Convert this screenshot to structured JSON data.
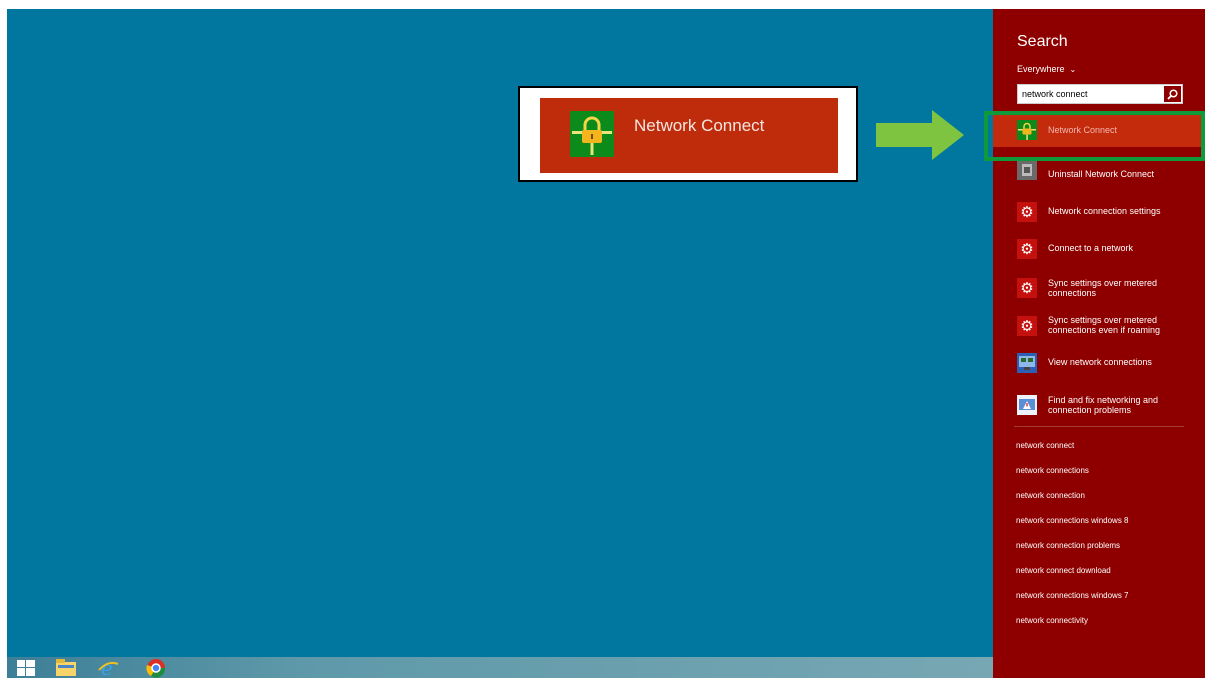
{
  "desktop": {
    "background": "#01779f"
  },
  "callout": {
    "label": "Network Connect"
  },
  "charm": {
    "title": "Search",
    "scope_label": "Everywhere",
    "search": {
      "value": "network connect"
    },
    "results": [
      {
        "icon": "network-connect-lock-icon",
        "dim": "",
        "bold": "Network Connect",
        "label": "Network Connect"
      },
      {
        "icon": "uninstall-program-icon",
        "label": "Uninstall Network Connect"
      },
      {
        "icon": "settings-gear-icon",
        "label": "Network connection settings"
      },
      {
        "icon": "settings-gear-icon",
        "label": "Connect to a network"
      },
      {
        "icon": "settings-gear-icon",
        "label": "Sync settings over metered connections"
      },
      {
        "icon": "settings-gear-icon",
        "label": "Sync settings over metered connections even if roaming"
      },
      {
        "icon": "network-connections-icon",
        "label": "View network connections"
      },
      {
        "icon": "troubleshoot-icon",
        "label": "Find and fix networking and connection problems"
      }
    ],
    "suggestions": [
      "network connect",
      "network connections",
      "network connection",
      "network connections windows 8",
      "network connection problems",
      "network connect download",
      "network connections windows 7",
      "network connectivity"
    ]
  },
  "colors": {
    "charm_bg": "#8e0000",
    "selected_bg": "#c42b0c",
    "highlight": "#0e9a3b",
    "arrow": "#7fc440"
  },
  "taskbar": {
    "icons": [
      "start-icon",
      "file-explorer-icon",
      "internet-explorer-icon",
      "chrome-icon"
    ]
  }
}
